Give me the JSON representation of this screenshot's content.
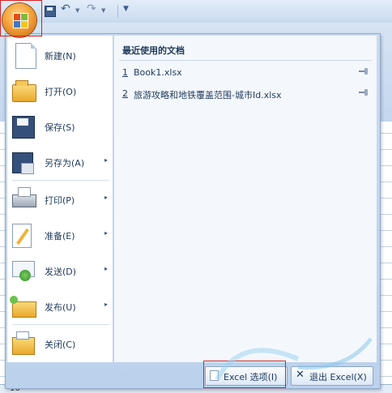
{
  "quick_access": {
    "save_icon": "save-icon",
    "undo_icon": "undo-icon",
    "redo_icon": "redo-icon",
    "customize_icon": "chevron-down-icon"
  },
  "office_button": {
    "icon": "office-logo-icon"
  },
  "menu": {
    "items": [
      {
        "label": "新建(N)",
        "icon": "new-document-icon",
        "submenu": false
      },
      {
        "label": "打开(O)",
        "icon": "open-folder-icon",
        "submenu": false
      },
      {
        "label": "保存(S)",
        "icon": "save-disk-icon",
        "submenu": false
      },
      {
        "label": "另存为(A)",
        "icon": "save-as-icon",
        "submenu": true
      },
      {
        "label": "打印(P)",
        "icon": "printer-icon",
        "submenu": true
      },
      {
        "label": "准备(E)",
        "icon": "prepare-icon",
        "submenu": true
      },
      {
        "label": "发送(D)",
        "icon": "send-icon",
        "submenu": true
      },
      {
        "label": "发布(U)",
        "icon": "publish-icon",
        "submenu": true
      },
      {
        "label": "关闭(C)",
        "icon": "close-folder-icon",
        "submenu": false
      }
    ],
    "submenu_arrow": "▸"
  },
  "recent": {
    "title": "最近使用的文档",
    "items": [
      {
        "num": "1",
        "name": "Book1.xlsx",
        "pin_icon": "pin-icon"
      },
      {
        "num": "2",
        "name": "旅游攻略和地铁覆盖范围-城市Id.xlsx",
        "pin_icon": "pin-icon"
      }
    ]
  },
  "footer": {
    "options_label": "Excel 选项(I)",
    "exit_label": "退出 Excel(X)",
    "exit_glyph": "✕"
  },
  "sheet": {
    "row_number": "16"
  },
  "colors": {
    "accent": "#1e395b",
    "highlight": "#d42222",
    "menu_bg": "#c9daf1"
  }
}
